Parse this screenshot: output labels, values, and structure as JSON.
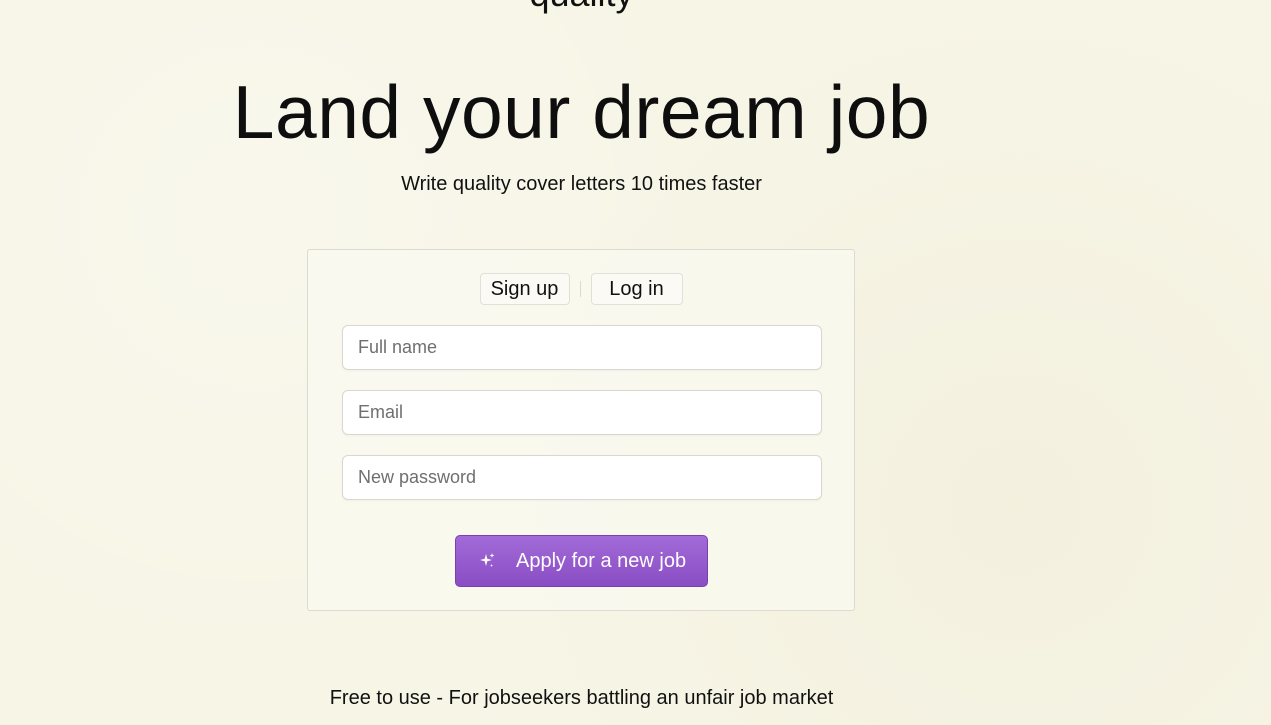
{
  "header": {
    "partial_top_text": "quality",
    "title": "Land your dream job",
    "subtitle": "Write quality cover letters 10 times faster"
  },
  "auth_card": {
    "tabs": {
      "signup_label": "Sign up",
      "login_label": "Log in"
    },
    "fields": {
      "full_name_placeholder": "Full name",
      "email_placeholder": "Email",
      "password_placeholder": "New password"
    },
    "submit": {
      "label": "Apply for a new job",
      "icon": "sparkle-icon"
    }
  },
  "footer": {
    "note": "Free to use - For jobseekers battling an unfair job market"
  },
  "colors": {
    "background": "#f7f5e6",
    "button_accent": "#9a5fd2",
    "button_text": "#ffffff"
  }
}
